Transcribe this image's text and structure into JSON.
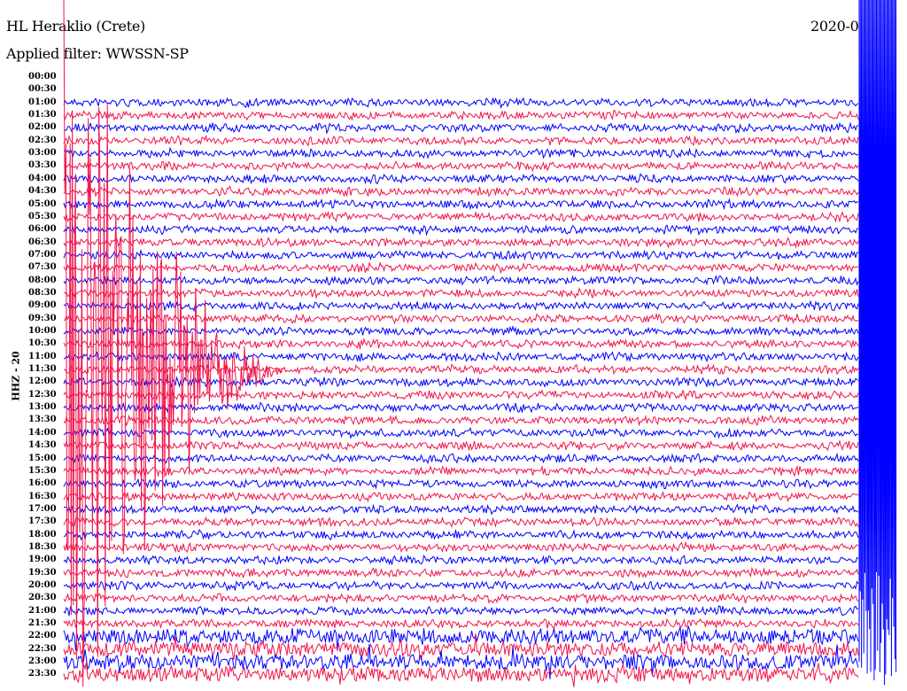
{
  "header": {
    "station": "HL Heraklio (Crete)",
    "filter": "Applied filter: WWSSN-SP",
    "date": "2020-0"
  },
  "chart_data": {
    "type": "line",
    "title": "HL Heraklio (Crete)",
    "subtitle": "Applied filter: WWSSN-SP",
    "ylabel": "HHZ - 20",
    "row_labels": [
      "00:00",
      "00:30",
      "01:00",
      "01:30",
      "02:00",
      "02:30",
      "03:00",
      "03:30",
      "04:00",
      "04:30",
      "05:00",
      "05:30",
      "06:00",
      "06:30",
      "07:00",
      "07:30",
      "08:00",
      "08:30",
      "09:00",
      "09:30",
      "10:00",
      "10:30",
      "11:00",
      "11:30",
      "12:00",
      "12:30",
      "13:00",
      "13:30",
      "14:00",
      "14:30",
      "15:00",
      "15:30",
      "16:00",
      "16:30",
      "17:00",
      "17:30",
      "18:00",
      "18:30",
      "19:00",
      "19:30",
      "20:00",
      "20:30",
      "21:00",
      "21:30",
      "22:00",
      "22:30",
      "23:00",
      "23:30"
    ],
    "series_colors": [
      "#0000ff",
      "#f0144a"
    ],
    "first_trace_row": "01:00",
    "grid": false
  }
}
